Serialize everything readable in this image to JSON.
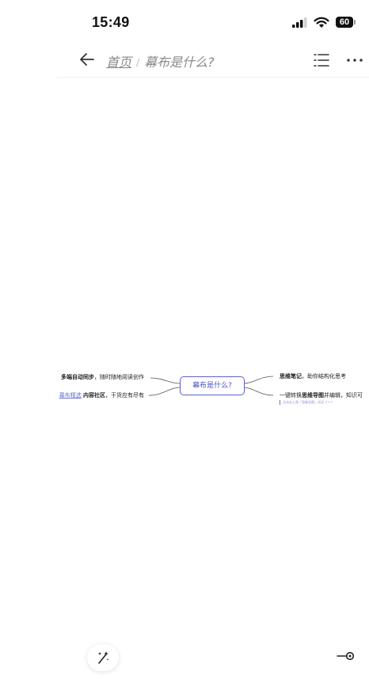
{
  "status_bar": {
    "time": "15:49",
    "battery": "60",
    "icons": [
      "signal-icon",
      "wifi-icon",
      "battery-icon"
    ]
  },
  "nav": {
    "back_icon": "arrow-left-icon",
    "home_label": "首页",
    "separator": "/",
    "doc_title": "幕布是什么?",
    "outline_icon": "list-icon",
    "more_icon": "more-icon"
  },
  "mindmap": {
    "root": "幕布是什么?",
    "left_nodes": [
      {
        "bold": "多端自动同步",
        "text": "，随时随地阅读创作"
      },
      {
        "link": "幕布精选",
        "bold": "内容社区",
        "text": "，干货应有尽有"
      }
    ],
    "right_nodes": [
      {
        "bold": "思维笔记",
        "text": "，助你结构化思考"
      },
      {
        "text_prefix": "一键转换",
        "bold": "思维导图",
        "text": "并编辑，知识可",
        "note": "点击右上角「思维导图」试试 ↗↗↗"
      }
    ],
    "line_color": "#555555",
    "accent_color": "#5a61c9"
  },
  "bottom": {
    "ai_icon": "magic-wand-icon",
    "node_icon": "connector-icon"
  }
}
